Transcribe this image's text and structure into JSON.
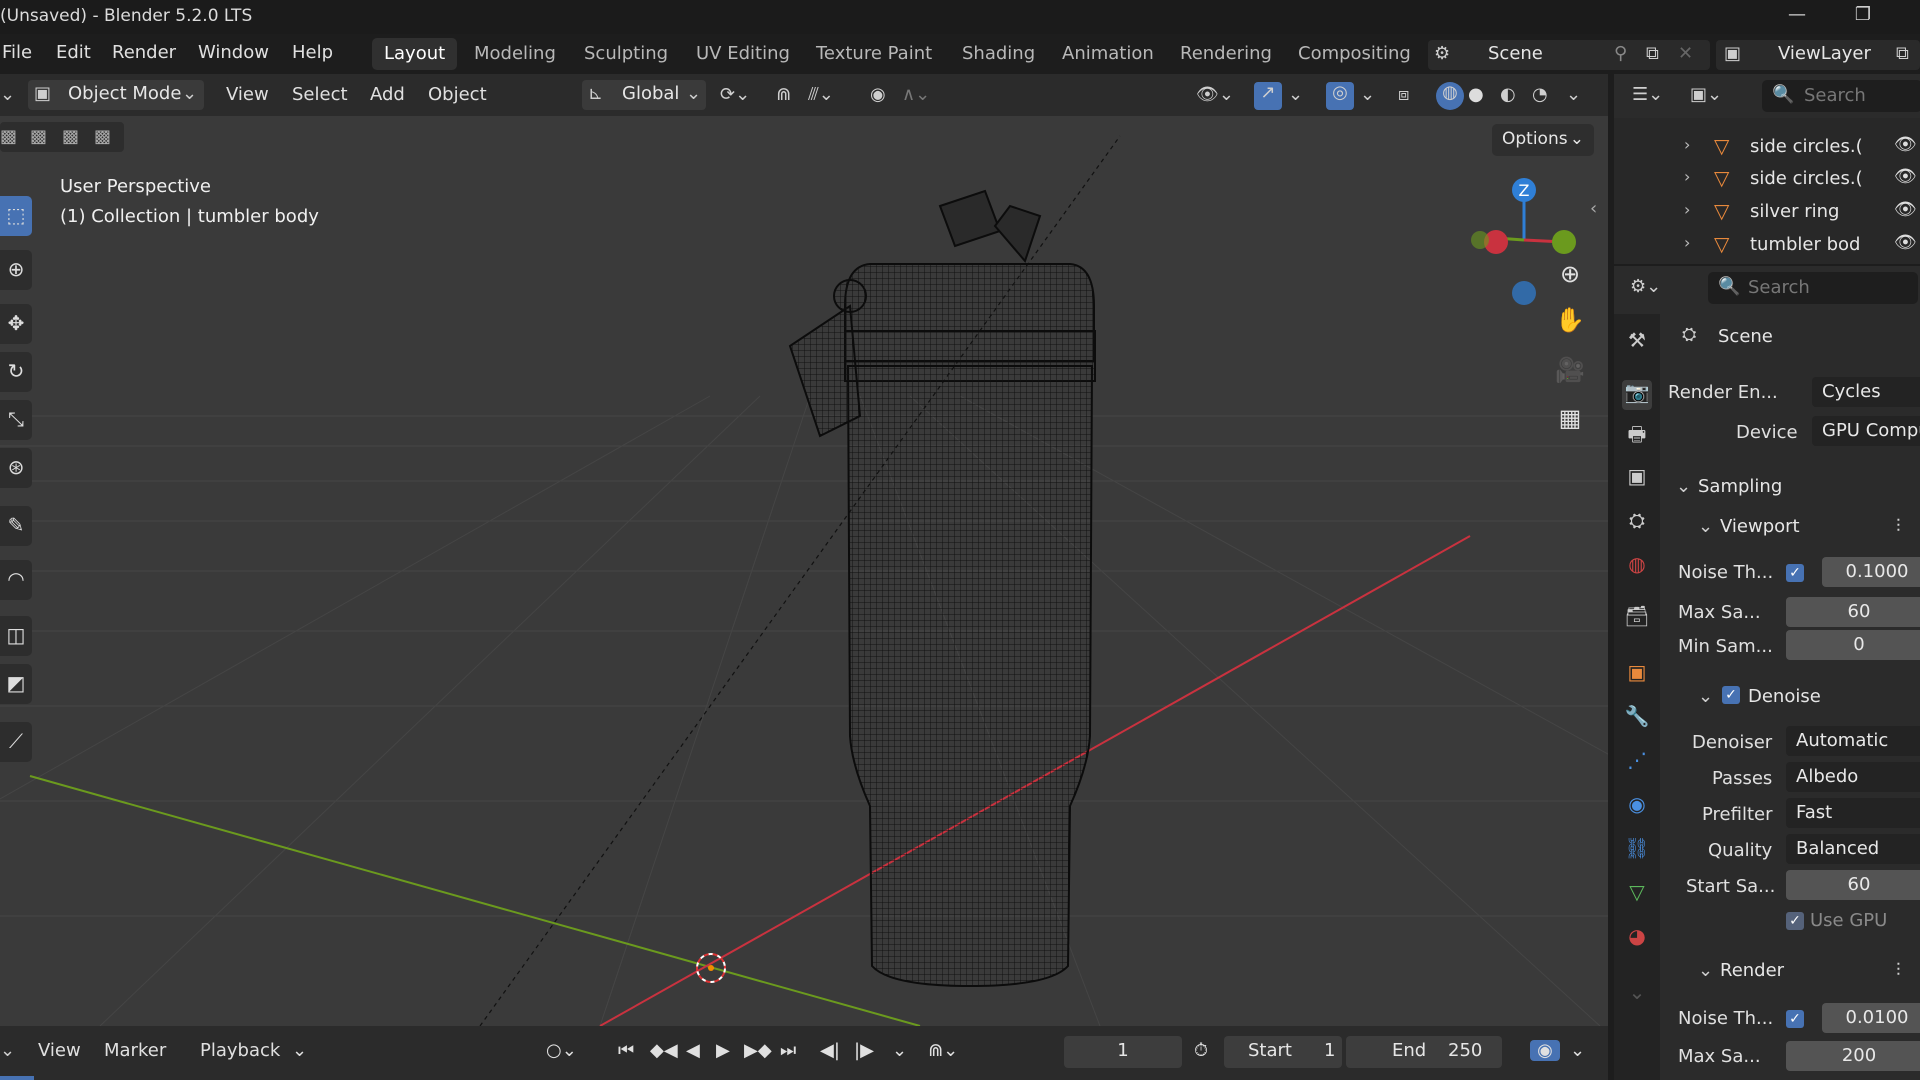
{
  "window": {
    "title": "(Unsaved) - Blender 5.2.0 LTS"
  },
  "menu": [
    "File",
    "Edit",
    "Render",
    "Window",
    "Help"
  ],
  "workspaces": [
    "Layout",
    "Modeling",
    "Sculpting",
    "UV Editing",
    "Texture Paint",
    "Shading",
    "Animation",
    "Rendering",
    "Compositing"
  ],
  "scene": {
    "name": "Scene",
    "view_layer": "ViewLayer"
  },
  "viewport_header": {
    "mode": "Object Mode",
    "menus": [
      "View",
      "Select",
      "Add",
      "Object"
    ],
    "orientation": "Global"
  },
  "viewport": {
    "view_name": "User Perspective",
    "collection_info": "(1) Collection | tumbler body",
    "options_label": "Options",
    "gizmo_axis": "Z"
  },
  "timeline": {
    "menus": [
      "View",
      "Marker",
      "Playback"
    ],
    "current_frame": "1",
    "start_label": "Start",
    "start_value": "1",
    "end_label": "End",
    "end_value": "250"
  },
  "outliner": {
    "search_placeholder": "Search",
    "items": [
      "side circles.(",
      "side circles.(",
      "silver ring",
      "tumbler bod"
    ]
  },
  "properties": {
    "search_placeholder": "Search",
    "context": "Scene",
    "render_engine_label": "Render En...",
    "render_engine": "Cycles",
    "device_label": "Device",
    "device": "GPU Compute",
    "sampling": "Sampling",
    "viewport_section": "Viewport",
    "vp_noise_label": "Noise Th...",
    "vp_noise": "0.1000",
    "vp_max_label": "Max Sa...",
    "vp_max": "60",
    "vp_min_label": "Min Sam...",
    "vp_min": "0",
    "denoise": "Denoise",
    "denoiser_label": "Denoiser",
    "denoiser": "Automatic",
    "passes_label": "Passes",
    "passes": "Albedo",
    "prefilter_label": "Prefilter",
    "prefilter": "Fast",
    "quality_label": "Quality",
    "quality": "Balanced",
    "start_label": "Start Sa...",
    "start": "60",
    "use_gpu": "Use GPU",
    "render_section": "Render",
    "r_noise_label": "Noise Th...",
    "r_noise": "0.0100",
    "r_max_label": "Max Sa...",
    "r_max": "200"
  },
  "colors": {
    "accent": "#4772b3",
    "x_axis": "#c9323f",
    "y_axis": "#6b9a1e",
    "z_axis": "#2f7fd6",
    "mesh_icon": "#e8893c"
  }
}
